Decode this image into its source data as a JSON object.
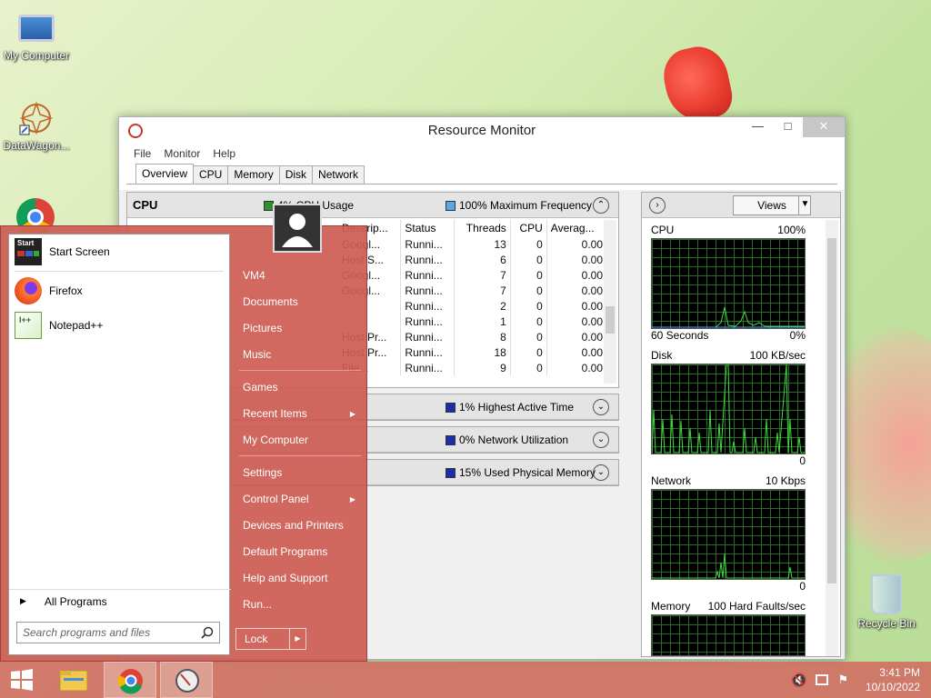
{
  "desktop": {
    "icons": [
      {
        "label": "My Computer"
      },
      {
        "label": "DataWagon..."
      },
      {
        "label": "Recycle Bin"
      }
    ]
  },
  "resource_monitor": {
    "title": "Resource Monitor",
    "menu": [
      "File",
      "Monitor",
      "Help"
    ],
    "tabs": [
      "Overview",
      "CPU",
      "Memory",
      "Disk",
      "Network"
    ],
    "active_tab": "Overview",
    "cpu_section": {
      "name": "CPU",
      "usage_label": "4% CPU Usage",
      "freq_label": "100% Maximum Frequency",
      "columns": [
        "Descrip...",
        "Status",
        "Threads",
        "CPU",
        "Averag..."
      ],
      "rows": [
        {
          "desc": "Googl...",
          "status": "Runni...",
          "threads": "13",
          "cpu": "0",
          "avg": "0.00"
        },
        {
          "desc": "Host S...",
          "status": "Runni...",
          "threads": "6",
          "cpu": "0",
          "avg": "0.00"
        },
        {
          "desc": "Googl...",
          "status": "Runni...",
          "threads": "7",
          "cpu": "0",
          "avg": "0.00"
        },
        {
          "desc": "Googl...",
          "status": "Runni...",
          "threads": "7",
          "cpu": "0",
          "avg": "0.00"
        },
        {
          "desc": "",
          "status": "Runni...",
          "threads": "2",
          "cpu": "0",
          "avg": "0.00"
        },
        {
          "desc": "",
          "status": "Runni...",
          "threads": "1",
          "cpu": "0",
          "avg": "0.00"
        },
        {
          "desc": "Host Pr...",
          "status": "Runni...",
          "threads": "8",
          "cpu": "0",
          "avg": "0.00"
        },
        {
          "desc": "Host Pr...",
          "status": "Runni...",
          "threads": "18",
          "cpu": "0",
          "avg": "0.00"
        },
        {
          "desc": "File...",
          "status": "Runni...",
          "threads": "9",
          "cpu": "0",
          "avg": "0.00"
        }
      ]
    },
    "disk_section": {
      "label": "1% Highest Active Time"
    },
    "network_section": {
      "label": "0% Network Utilization"
    },
    "memory_section": {
      "label": "15% Used Physical Memory"
    },
    "views_label": "Views",
    "graphs": [
      {
        "name": "CPU",
        "max": "100%",
        "left_bottom": "60 Seconds",
        "min": "0%"
      },
      {
        "name": "Disk",
        "max": "100 KB/sec",
        "left_bottom": "",
        "min": "0"
      },
      {
        "name": "Network",
        "max": "10 Kbps",
        "left_bottom": "",
        "min": "0"
      },
      {
        "name": "Memory",
        "max": "100 Hard Faults/sec",
        "left_bottom": "",
        "min": ""
      }
    ],
    "colors": {
      "cpu": "#2f8f2f",
      "freq": "#5aa7e8",
      "disk": "#1c2fa8",
      "network": "#1c2fa8",
      "memory": "#1c2fa8"
    }
  },
  "start_menu": {
    "pinned": [
      {
        "label": "Start Screen",
        "icon": "start-screen-icon"
      },
      {
        "label": "Firefox",
        "icon": "firefox-icon"
      },
      {
        "label": "Notepad++",
        "icon": "notepadpp-icon"
      }
    ],
    "all_programs": "All Programs",
    "search_placeholder": "Search programs and files",
    "right_items": [
      {
        "label": "VM4",
        "submenu": false
      },
      {
        "label": "Documents",
        "submenu": false
      },
      {
        "label": "Pictures",
        "submenu": false
      },
      {
        "label": "Music",
        "submenu": false
      },
      {
        "label": "Games",
        "submenu": false
      },
      {
        "label": "Recent Items",
        "submenu": true
      },
      {
        "label": "My Computer",
        "submenu": false
      },
      {
        "label": "Settings",
        "submenu": false
      },
      {
        "label": "Control Panel",
        "submenu": true
      },
      {
        "label": "Devices and Printers",
        "submenu": false
      },
      {
        "label": "Default Programs",
        "submenu": false
      },
      {
        "label": "Help and Support",
        "submenu": false
      },
      {
        "label": "Run...",
        "submenu": false
      }
    ],
    "lock_label": "Lock"
  },
  "taskbar": {
    "clock_time": "3:41 PM",
    "clock_date": "10/10/2022"
  }
}
